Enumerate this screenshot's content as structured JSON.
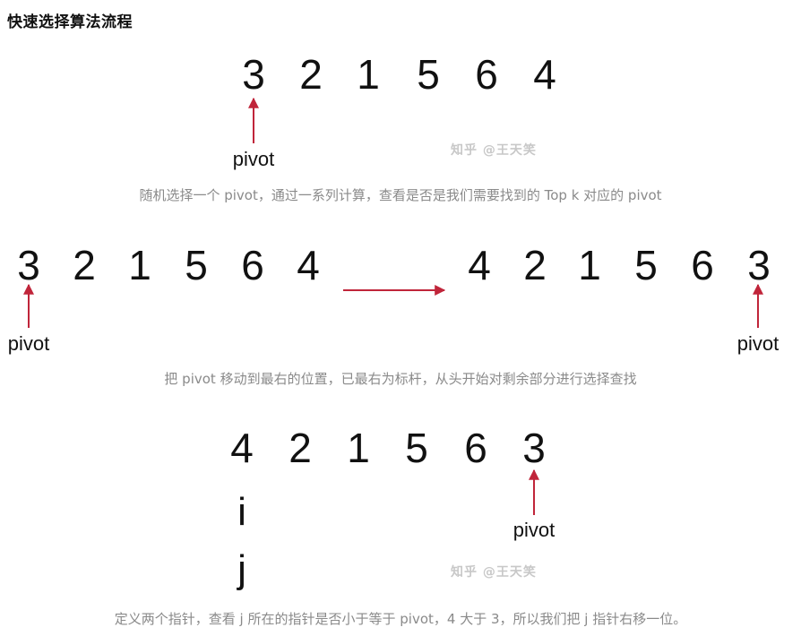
{
  "title": "快速选择算法流程",
  "watermark": "知乎 @王天笑",
  "step1": {
    "numbers": [
      "3",
      "2",
      "1",
      "5",
      "6",
      "4"
    ],
    "pivot_label": "pivot",
    "caption": "随机选择一个 pivot，通过一系列计算，查看是否是我们需要找到的 Top k 对应的 pivot"
  },
  "step2": {
    "before_numbers": [
      "3",
      "2",
      "1",
      "5",
      "6",
      "4"
    ],
    "after_numbers": [
      "4",
      "2",
      "1",
      "5",
      "6",
      "3"
    ],
    "pivot_label_left": "pivot",
    "pivot_label_right": "pivot",
    "caption": "把 pivot 移动到最右的位置，已最右为标杆，从头开始对剩余部分进行选择查找"
  },
  "step3": {
    "numbers": [
      "4",
      "2",
      "1",
      "5",
      "6",
      "3"
    ],
    "pointer_i": "i",
    "pointer_j": "j",
    "pivot_label": "pivot",
    "caption": "定义两个指针，查看 j 所在的指针是否小于等于 pivot，4 大于 3，所以我们把 j 指针右移一位。"
  },
  "colors": {
    "arrow": "#c0253a",
    "caption": "#8a8a8a",
    "text": "#111111"
  }
}
